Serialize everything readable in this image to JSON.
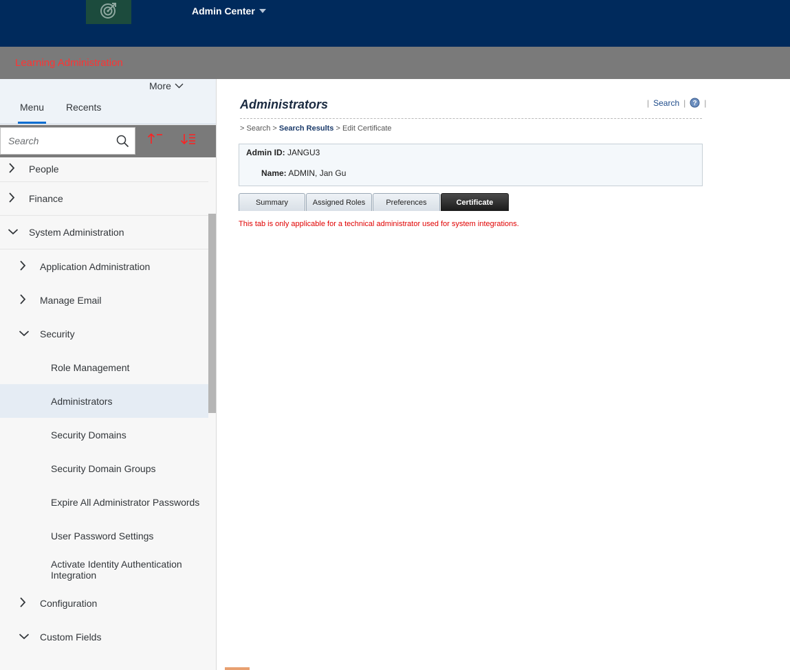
{
  "header": {
    "logo_icon": "target-icon",
    "app_title": "Admin Center"
  },
  "subheader": {
    "title": "Learning Administration"
  },
  "sidebar": {
    "more_label": "More",
    "tabs": [
      {
        "label": "Menu",
        "active": true
      },
      {
        "label": "Recents",
        "active": false
      }
    ],
    "search_placeholder": "Search",
    "items": [
      {
        "label": "People",
        "level": 0,
        "state": "collapsed"
      },
      {
        "label": "Finance",
        "level": 0,
        "state": "collapsed"
      },
      {
        "label": "System Administration",
        "level": 0,
        "state": "expanded"
      },
      {
        "label": "Application Administration",
        "level": 1,
        "state": "collapsed"
      },
      {
        "label": "Manage Email",
        "level": 1,
        "state": "collapsed"
      },
      {
        "label": "Security",
        "level": 1,
        "state": "expanded"
      },
      {
        "label": "Role Management",
        "level": 2
      },
      {
        "label": "Administrators",
        "level": 2,
        "selected": true
      },
      {
        "label": "Security Domains",
        "level": 2
      },
      {
        "label": "Security Domain Groups",
        "level": 2
      },
      {
        "label": "Expire All Administrator Passwords",
        "level": 2
      },
      {
        "label": "User Password Settings",
        "level": 2
      },
      {
        "label": "Activate Identity Authentication Integration",
        "level": 2
      },
      {
        "label": "Configuration",
        "level": 1,
        "state": "collapsed"
      },
      {
        "label": "Custom Fields",
        "level": 1,
        "state": "expanded"
      }
    ]
  },
  "main": {
    "page_title": "Administrators",
    "top_links": {
      "search": "Search"
    },
    "breadcrumb": {
      "sep": ">",
      "search": "Search",
      "results": "Search Results",
      "current": "Edit Certificate"
    },
    "admin_info": {
      "id_label": "Admin ID:",
      "id_value": "JANGU3",
      "name_label": "Name:",
      "name_value": "ADMIN, Jan Gu"
    },
    "tabs": [
      {
        "label": "Summary",
        "active": false
      },
      {
        "label": "Assigned Roles",
        "active": false
      },
      {
        "label": "Preferences",
        "active": false
      },
      {
        "label": "Certificate",
        "active": true
      }
    ],
    "notice": "This tab is only applicable for a technical administrator used for system integrations."
  },
  "colors": {
    "shell": "#002a5c",
    "subbar": "#7a7a7a",
    "subbar_title": "#ff3333",
    "notice": "#e00000",
    "accent": "#0a6ed1"
  }
}
